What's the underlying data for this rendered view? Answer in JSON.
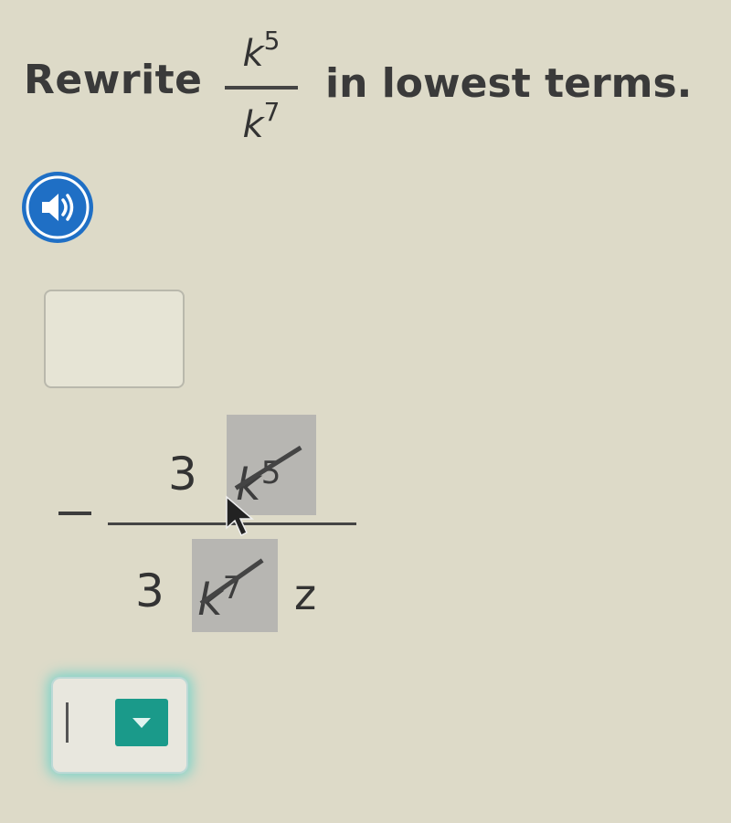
{
  "question": {
    "prefix": "Rewrite",
    "numerator_base": "k",
    "numerator_exp": "5",
    "denominator_base": "k",
    "denominator_exp": "7",
    "suffix": "in lowest terms."
  },
  "audio_button": {
    "icon": "speaker-icon",
    "color": "#1f6fc5"
  },
  "answer": {
    "sign": "−",
    "numerator_coefficient": "3",
    "numerator_slot": {
      "base": "k",
      "exp": "5"
    },
    "denominator_coefficient": "3",
    "denominator_slot": {
      "base": "k",
      "exp": "7"
    },
    "denominator_variable": "z"
  },
  "answer_input": {
    "value": "",
    "dropdown_icon": "chevron-down-icon",
    "accent_color": "#1a9a8a"
  },
  "colors": {
    "background": "#dddac8",
    "slot": "#b7b6b2",
    "focus_glow": "#7fd3c9"
  }
}
